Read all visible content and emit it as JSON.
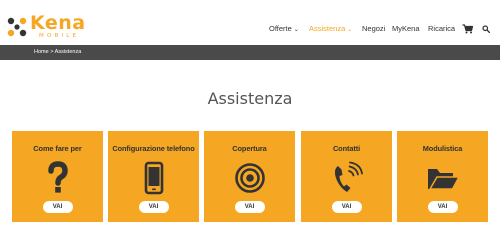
{
  "brand": {
    "name": "Kena",
    "tagline": "MOBILE",
    "accent": "#f5a623"
  },
  "nav": {
    "items": [
      {
        "label": "Offerte",
        "has_dropdown": true,
        "active": false
      },
      {
        "label": "Assistenza",
        "has_dropdown": true,
        "active": true
      },
      {
        "label": "Negozi",
        "has_dropdown": false,
        "active": false
      },
      {
        "label": "MyKena",
        "has_dropdown": false,
        "active": false
      },
      {
        "label": "Ricarica",
        "has_dropdown": false,
        "active": false
      }
    ],
    "cart_icon": "cart-icon",
    "search_icon": "search-icon"
  },
  "breadcrumb": {
    "home": "Home",
    "separator": ">",
    "current": "Assistenza"
  },
  "page": {
    "title": "Assistenza"
  },
  "cards": [
    {
      "title": "Come fare per",
      "icon": "question-icon",
      "button": "VAI"
    },
    {
      "title": "Configurazione telefono",
      "icon": "phone-icon",
      "button": "VAI"
    },
    {
      "title": "Copertura",
      "icon": "coverage-icon",
      "button": "VAI"
    },
    {
      "title": "Contatti",
      "icon": "phone-call-icon",
      "button": "VAI"
    },
    {
      "title": "Modulistica",
      "icon": "folder-open-icon",
      "button": "VAI"
    }
  ],
  "colors": {
    "card_bg": "#f5a623",
    "bar_bg": "#4a4a4a",
    "nav_active": "#f5a623"
  }
}
